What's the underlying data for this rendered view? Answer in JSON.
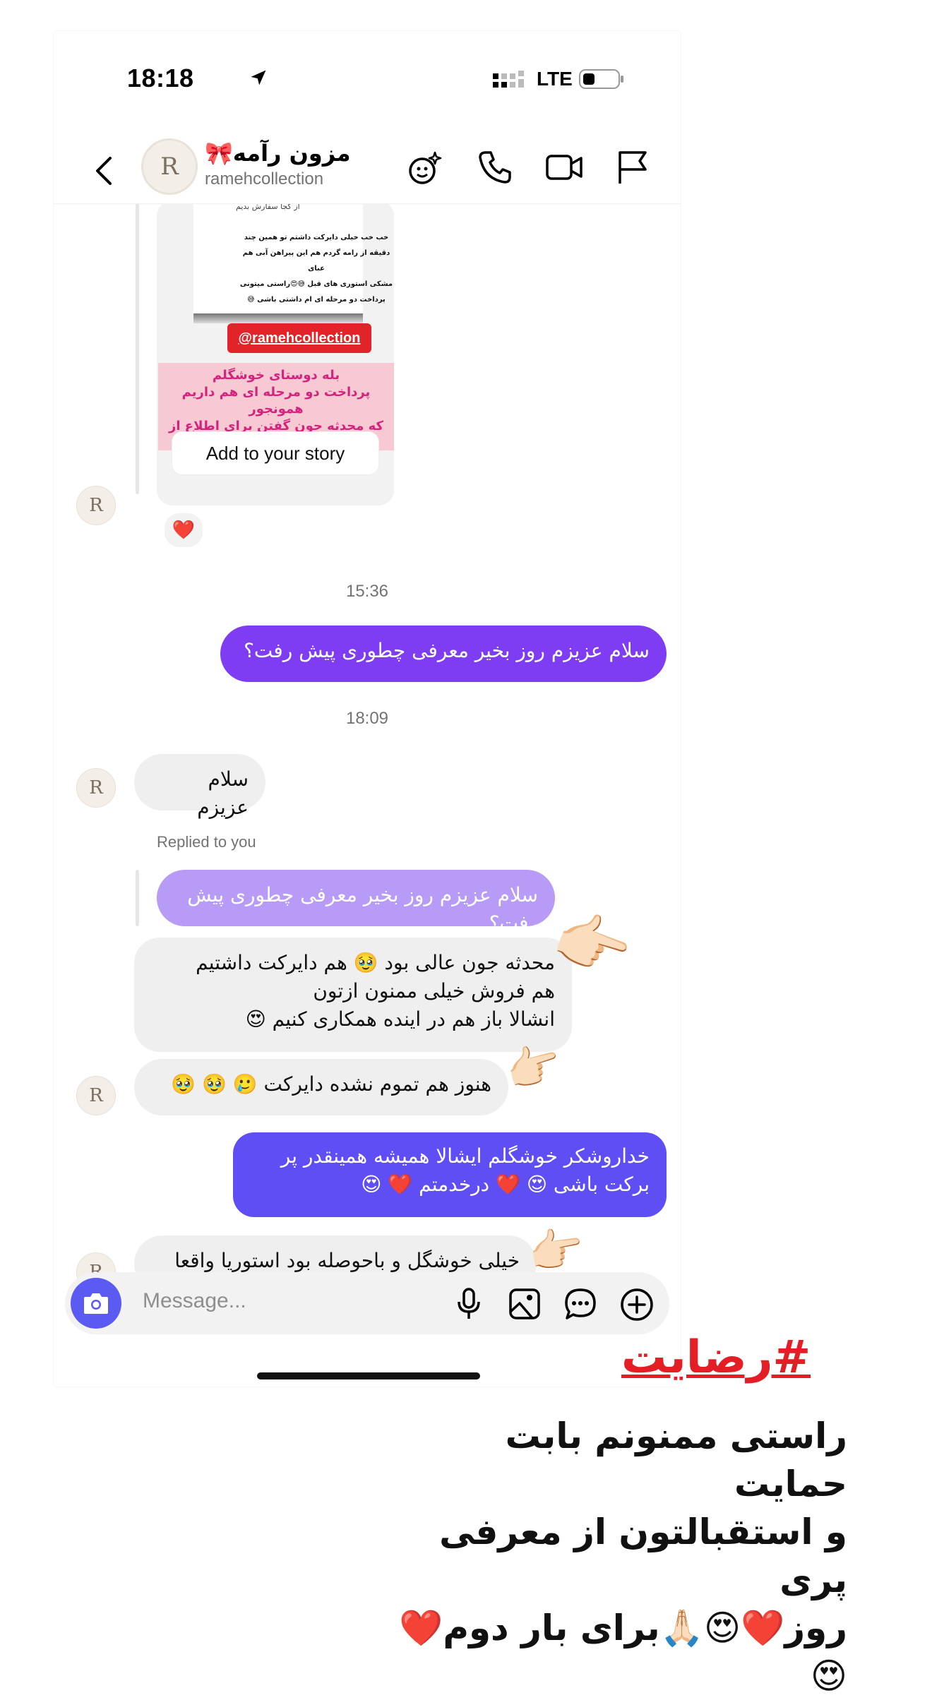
{
  "status": {
    "time": "18:18",
    "network": "LTE"
  },
  "header": {
    "name": "مزون رآمه🎀",
    "username": "ramehcollection",
    "avatar_letter": "R"
  },
  "story": {
    "ask": "از کجا سفارش بدیم",
    "lines": [
      "خب خب خیلی دایرکت داشتم تو همین چند",
      "دقیقه از رامه گردم هم این پیراهن آبی هم عبای",
      "مشکی استوری های قبل 😅😍راستی میتونی",
      "پرداخت دو مرحله ای ام داشتی باشی 😅"
    ],
    "tag": "@ramehcollection",
    "pink_lines": [
      "بله دوستای خوشگلم",
      "پرداخت دو مرحله ای  هم داریم همونجور",
      "که محدثه جون گفتن برای اطلاع از شرایط"
    ],
    "add_button": "Add to your story",
    "reaction": "❤️"
  },
  "messages": {
    "ts1": "15:36",
    "out1": "سلام عزیزم روز بخیر معرفی چطوری پیش رفت؟",
    "ts2": "18:09",
    "in1": "سلام عزیزم",
    "replied_label": "Replied to you",
    "quote": "سلام عزیزم روز بخیر معرفی چطوری پیش رفت؟",
    "in2_l1": "محدثه جون عالی بود 🥹 هم دایرکت داشتیم",
    "in2_l2": "هم فروش خیلی ممنون ازتون",
    "in2_l3": "انشالا باز هم در اینده همکاری کنیم 😍",
    "in3": "هنوز هم تموم نشده دایرکت 🥲 🥹 🥹",
    "out2_l1": "خداروشکر خوشگلم ایشالا همیشه همینقدر پر",
    "out2_l2": "برکت باشی 😍 ❤️ درخدمتم ❤️ 😍",
    "in4": "خیلی خوشگل و باحوصله بود استوریا واقعا",
    "hand": "👉🏻"
  },
  "composer": {
    "placeholder": "Message..."
  },
  "overlay": {
    "tag": "#رضایت",
    "line1": "راستی ممنونم بابت حمایت",
    "line2": "و استقبالتون از معرفی پری",
    "line3": "روز❤️😍🙏🏻برای بار دوم❤️😍"
  },
  "colors": {
    "outgoing_top": "#7e3cf3",
    "outgoing_bottom": "#5e4ef3",
    "camera": "#5b5bf4",
    "tag_red": "#e31e24"
  },
  "icons": [
    "location-arrow-icon",
    "signal-icon",
    "battery-icon",
    "back-chevron-icon",
    "effects-icon",
    "phone-icon",
    "video-icon",
    "flag-icon",
    "camera-icon",
    "microphone-icon",
    "gallery-icon",
    "sticker-icon",
    "plus-icon"
  ]
}
